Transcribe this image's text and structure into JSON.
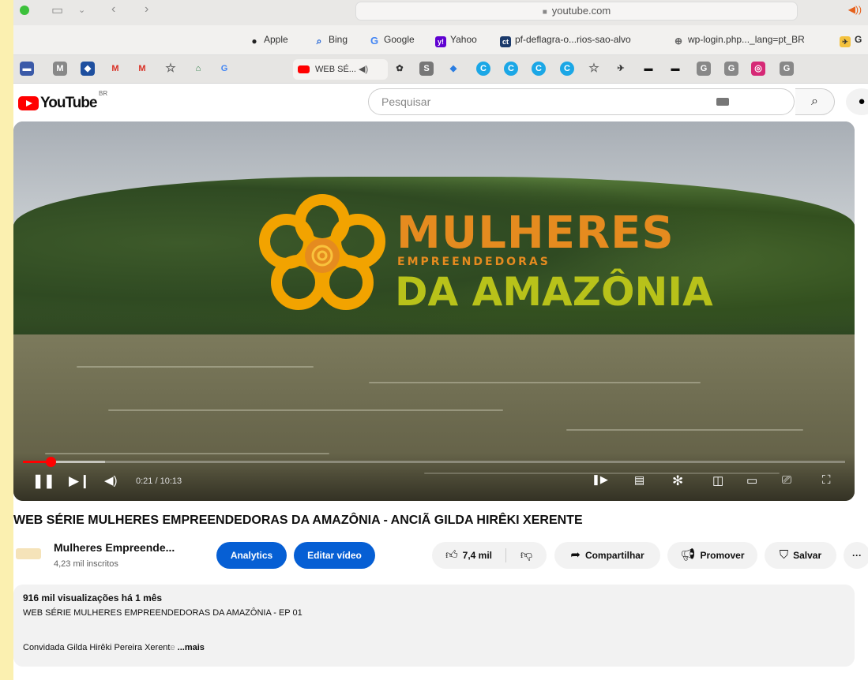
{
  "browser": {
    "url": "youtube.com",
    "favorites": [
      {
        "label": "Apple",
        "icon": "apple-icon"
      },
      {
        "label": "Bing",
        "icon": "search-icon"
      },
      {
        "label": "Google",
        "icon": "google-icon"
      },
      {
        "label": "Yahoo",
        "icon": "yahoo-icon"
      },
      {
        "label": "pf-deflagra-o...rios-sao-alvo",
        "icon": "ct-icon"
      },
      {
        "label": "wp-login.php..._lang=pt_BR",
        "icon": "globe-icon"
      },
      {
        "label": "G",
        "icon": "bird-icon"
      }
    ],
    "active_tab": "WEB SÉ..."
  },
  "youtube": {
    "logo_text": "YouTube",
    "country": "BR",
    "search_placeholder": "Pesquisar"
  },
  "player": {
    "overlay": {
      "line1": "MULHERES",
      "line2": "EMPREENDEDORAS",
      "line3": "DA AMAZÔNIA"
    },
    "time": "0:21 / 10:13",
    "progress": 0.034,
    "buffered": 0.1,
    "colors": {
      "accent": "#ff0000",
      "orange": "#e58b1f",
      "green": "#b8c21a"
    }
  },
  "video": {
    "title": "WEB SÉRIE MULHERES EMPREENDEDORAS DA AMAZÔNIA - ANCIÃ GILDA HIRÊKI XERENTE",
    "channel_name": "Mulheres Empreende...",
    "subscribers": "4,23 mil inscritos",
    "analytics_label": "Analytics",
    "edit_label": "Editar vídeo",
    "likes": "7,4 mil",
    "share_label": "Compartilhar",
    "promote_label": "Promover",
    "save_label": "Salvar",
    "more_label": "···"
  },
  "description": {
    "meta": "916 mil visualizações  há 1 mês",
    "line1": "WEB SÉRIE MULHERES EMPREENDEDORAS DA AMAZÔNIA - EP 01",
    "line2_main": "Convidada Gilda Hirêki Pereira Xerent",
    "line2_fade": "e",
    "more": " ...mais"
  }
}
